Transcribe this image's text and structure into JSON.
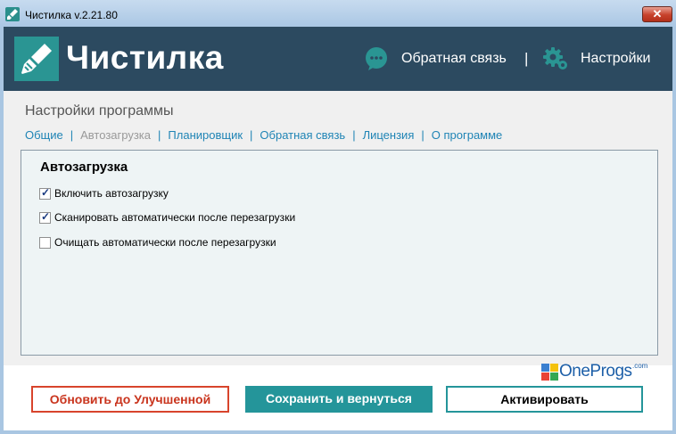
{
  "window": {
    "title": "Чистилка v.2.21.80",
    "close_label": "✕"
  },
  "header": {
    "logo_text": "Чистилка",
    "feedback_label": "Обратная связь",
    "separator": "|",
    "settings_label": "Настройки"
  },
  "page": {
    "heading": "Настройки программы"
  },
  "tabs": [
    {
      "label": "Общие",
      "active": false
    },
    {
      "label": "Автозагрузка",
      "active": true
    },
    {
      "label": "Планировщик",
      "active": false
    },
    {
      "label": "Обратная связь",
      "active": false
    },
    {
      "label": "Лицензия",
      "active": false
    },
    {
      "label": "О программе",
      "active": false
    }
  ],
  "tab_separator": "|",
  "panel": {
    "title": "Автозагрузка",
    "options": [
      {
        "label": "Включить автозагрузку",
        "checked": true
      },
      {
        "label": "Сканировать автоматически после перезагрузки",
        "checked": true
      },
      {
        "label": "Очищать автоматически после перезагрузки",
        "checked": false
      }
    ]
  },
  "footer": {
    "upgrade_label": "Обновить до Улучшенной",
    "save_label": "Сохранить и вернуться",
    "activate_label": "Активировать"
  },
  "watermark": {
    "text": "OneProgs",
    "suffix": ".com"
  },
  "colors": {
    "header_bg": "#2c4a60",
    "accent_teal": "#24959a",
    "upgrade_red": "#d8442c",
    "link_blue": "#1f84b5"
  }
}
